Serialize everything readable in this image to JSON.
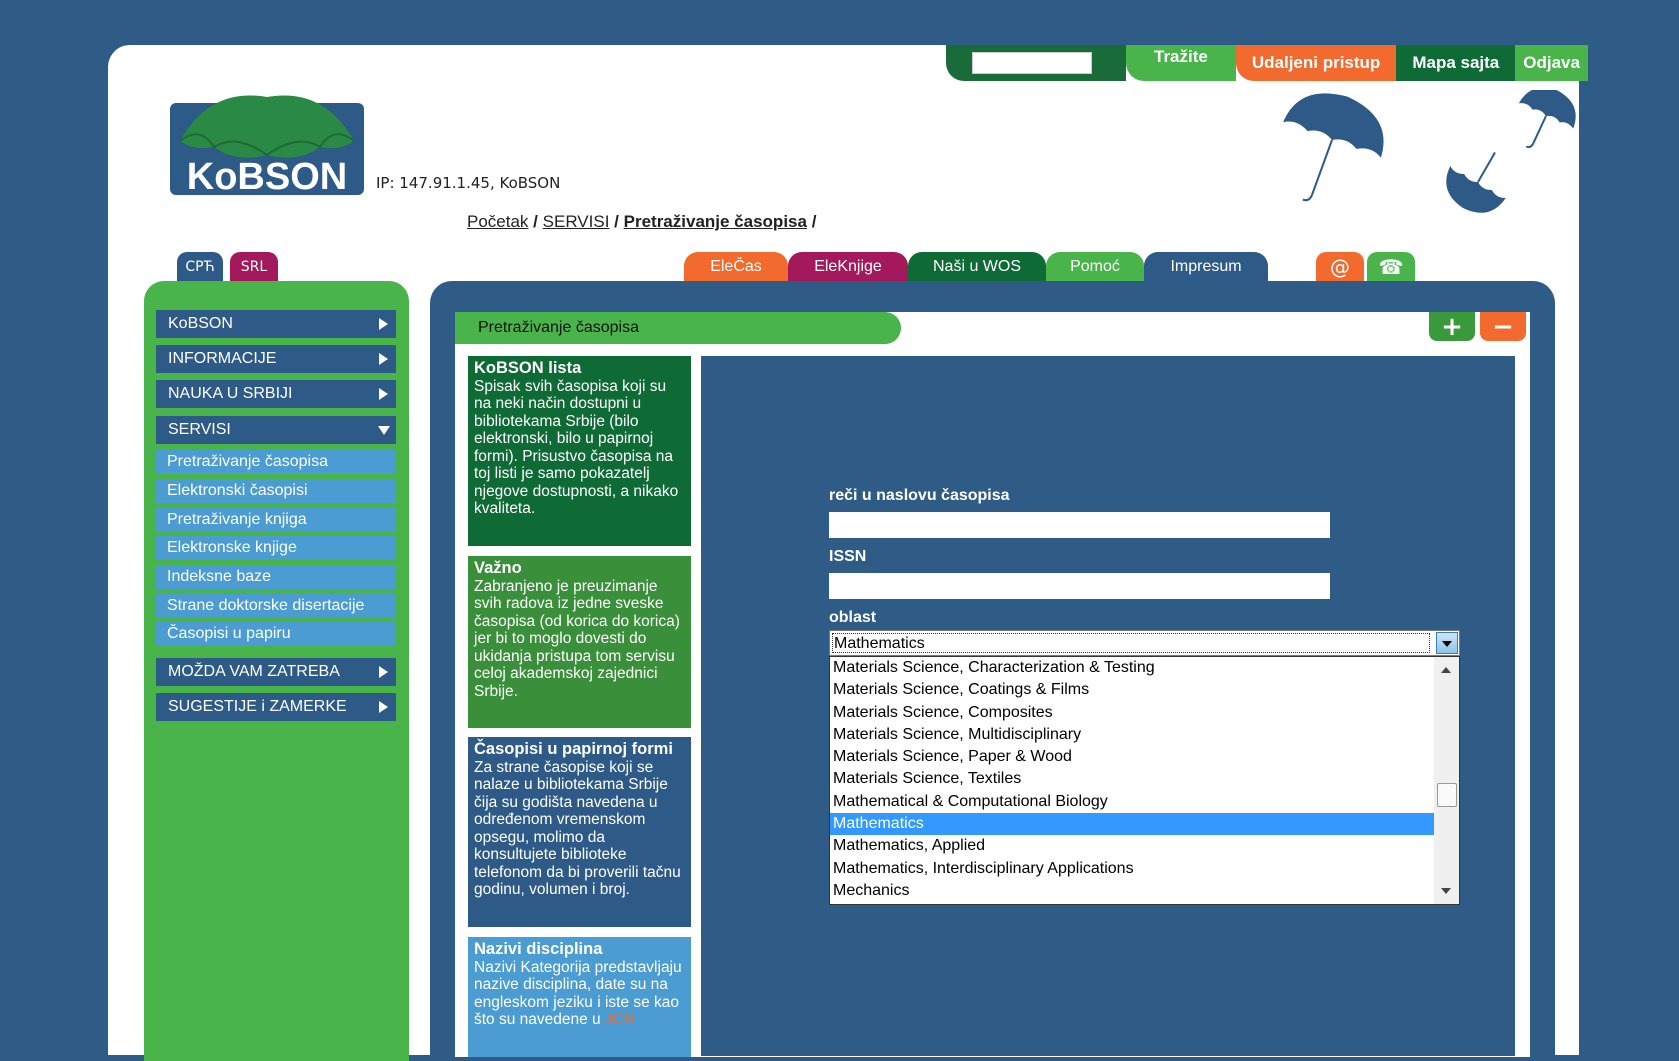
{
  "topbar": {
    "search_value": "",
    "search_button": "Tražite",
    "remote_access": "Udaljeni pristup",
    "sitemap": "Mapa sajta",
    "logout": "Odjava"
  },
  "logo_text": "KoBSON",
  "ip_text": "IP: 147.91.1.45, KoBSON",
  "breadcrumb": {
    "home": "Početak",
    "services": "SERVISI",
    "current": "Pretraživanje časopisa",
    "sep": "/"
  },
  "languages": [
    "СРЋ",
    "SRL"
  ],
  "tabs": [
    "EleČas",
    "EleKnjige",
    "Naši u WOS",
    "Pomoć",
    "Impresum"
  ],
  "icon_tabs": {
    "email": "@",
    "phone": "☎"
  },
  "sidebar": {
    "menus": [
      "KoBSON",
      "INFORMACIJE",
      "NAUKA U SRBIJI",
      "SERVISI"
    ],
    "servisi_items": [
      "Pretraživanje časopisa",
      "Elektronski časopisi",
      "Pretraživanje knjiga",
      "Elektronske knjige",
      "Indeksne baze",
      "Strane doktorske disertacije",
      "Časopisi u papiru"
    ],
    "bottom_menus": [
      "MOŽDA VAM ZATREBA",
      "SUGESTIJE i ZAMERKE"
    ]
  },
  "panel": {
    "title": "Pretraživanje časopisa",
    "plus": "+",
    "minus": "−"
  },
  "infoboxes": [
    {
      "title": "KoBSON lista",
      "text": "Spisak svih časopisa koji su na neki način dostupni u bibliotekama Srbije (bilo elektronski, bilo u papirnoj formi). Prisustvo časopisa na toj listi je samo pokazatelj njegove dostupnosti, a nikako kvaliteta."
    },
    {
      "title": "Važno",
      "text": "Zabranjeno je preuzimanje svih radova iz jedne sveske časopisa (od korica do korica) jer bi to moglo dovesti do ukidanja pristupa tom servisu celoj akademskoj zajednici Srbije."
    },
    {
      "title": "Časopisi u papirnoj formi",
      "text": "Za strane časopise koji se nalaze u bibliotekama Srbije čija su godišta navedena u određenom vremenskom opsegu, molimo da konsultujete biblioteke telefonom da bi proverili tačnu godinu, volumen i broj."
    },
    {
      "title": "Nazivi disciplina",
      "text": "Nazivi Kategorija predstavljaju nazive disciplina, date su na engleskom jeziku i iste se kao što su navedene u",
      "link": "JCR"
    }
  ],
  "form": {
    "title_words_label": "reči u naslovu časopisa",
    "title_words_value": "",
    "issn_label": "ISSN",
    "issn_value": "",
    "field_label": "oblast",
    "field_selected": "Mathematics",
    "field_options_visible": [
      "Materials Science,  Characterization & Testing",
      "Materials Science,  Coatings & Films",
      "Materials Science,  Composites",
      "Materials Science,  Multidisciplinary",
      "Materials Science,  Paper & Wood",
      "Materials Science,  Textiles",
      "Mathematical & Computational Biology",
      "Mathematics",
      "Mathematics,  Applied",
      "Mathematics,  Interdisciplinary Applications",
      "Mechanics"
    ],
    "highlighted_index": 7
  },
  "colors": {
    "background": "#2f5c86",
    "green": "#49b44a",
    "dark_green": "#0f6b35",
    "orange": "#f26a2e",
    "magenta": "#a3195b",
    "blue": "#4a9cd2",
    "select_highlight": "#3399ff"
  }
}
